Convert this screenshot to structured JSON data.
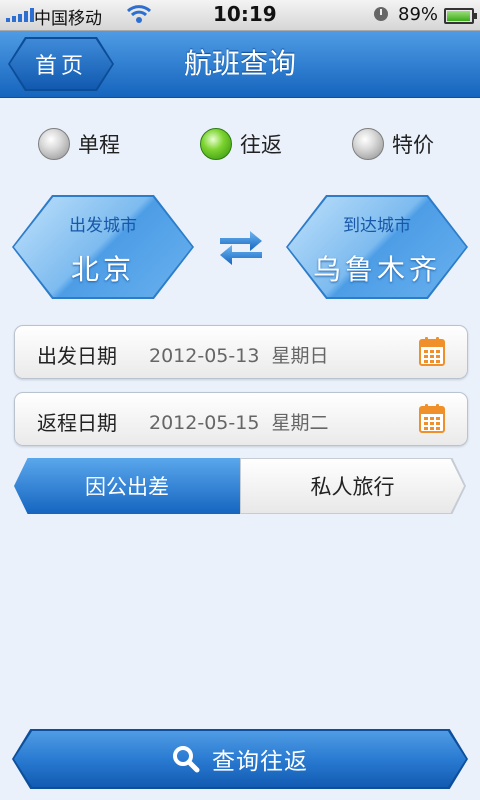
{
  "status_bar": {
    "carrier": "中国移动",
    "time": "10:19",
    "battery_percent": "89%",
    "battery_level": 0.89
  },
  "header": {
    "back_label": "首页",
    "title": "航班查询"
  },
  "trip_types": [
    {
      "label": "单程",
      "selected": false
    },
    {
      "label": "往返",
      "selected": true
    },
    {
      "label": "特价",
      "selected": false
    }
  ],
  "departure_city": {
    "caption": "出发城市",
    "name": "北京"
  },
  "arrival_city": {
    "caption": "到达城市",
    "name": "乌鲁木齐"
  },
  "depart_date": {
    "label": "出发日期",
    "value": "2012-05-13  星期日"
  },
  "return_date": {
    "label": "返程日期",
    "value": "2012-05-15  星期二"
  },
  "travel_purpose": {
    "options": [
      "因公出差",
      "私人旅行"
    ],
    "selected": "因公出差"
  },
  "search_button": {
    "label": "查询往返"
  },
  "colors": {
    "accent_blue": "#1565be",
    "selected_green": "#7cd32f",
    "calendar_orange": "#f0902a"
  },
  "icons": {
    "back": "home-back-chevron",
    "swap": "swap-arrows-icon",
    "calendar": "calendar-icon",
    "search": "search-icon"
  }
}
